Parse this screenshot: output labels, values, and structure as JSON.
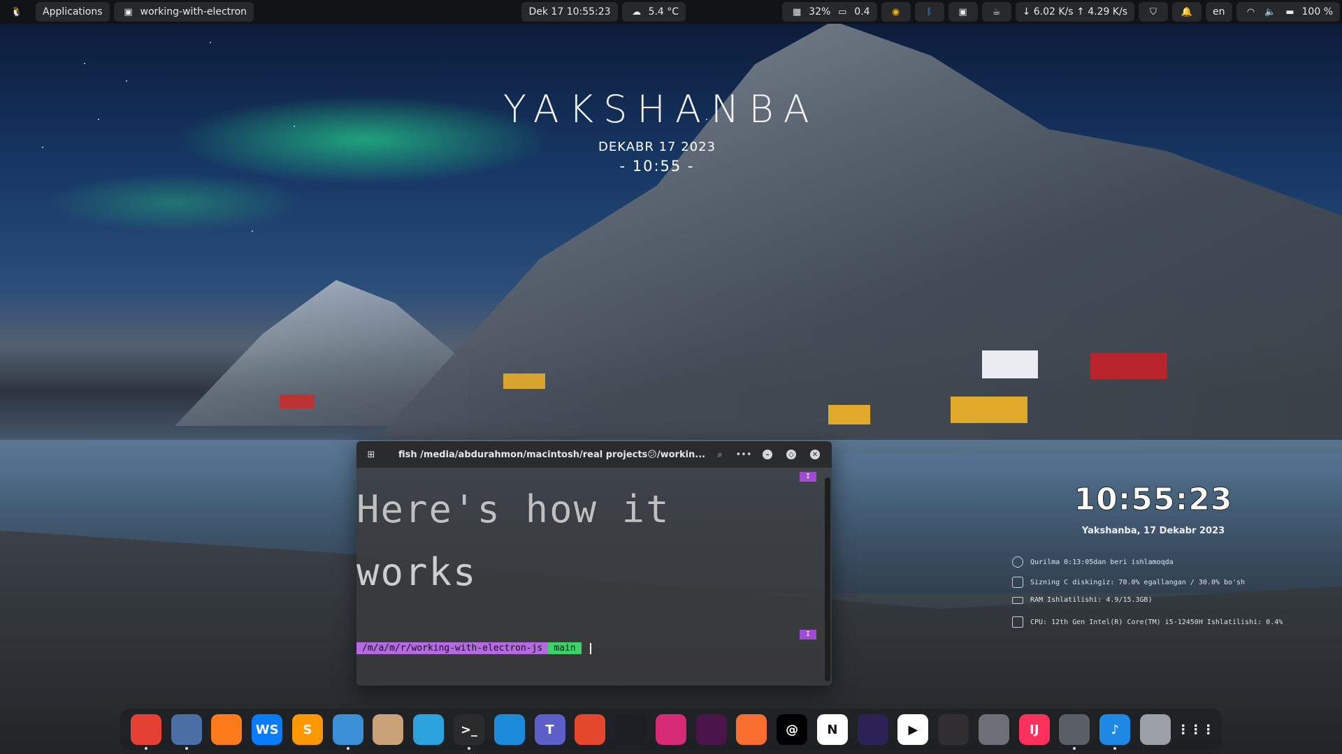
{
  "topbar": {
    "menu_label": "Applications",
    "window_label": "working-with-electron",
    "datetime": "Dek 17  10:55:23",
    "weather": "5.4 °C",
    "cpu": "32%",
    "load": "0.4",
    "network": "↓ 6.02 K/s ↑ 4.29 K/s",
    "language": "en",
    "battery": "100 %"
  },
  "desktop_clock": {
    "day": "YAKSHANBA",
    "date": "DEKABR 17 2023",
    "time": "- 10:55  -"
  },
  "widget": {
    "time": "10:55:23",
    "date": "Yakshanba, 17 Dekabr 2023",
    "uptime": "Qurilma 0:13:05dan beri ishlamoqda",
    "disk": "Sizning C diskingiz: 70.0% egallangan / 30.0% bo'sh",
    "ram": "RAM Ishlatilishi: 4.9/15.3GB)",
    "cpu": "CPU: 12th Gen Intel(R) Core(TM) i5-12450H Ishlatilishi: 0.4%"
  },
  "terminal": {
    "title": "fish /media/abdurahmon/macintosh/real projects😕/workin...",
    "ascii_line1": "Here's how it",
    "ascii_line2": "works",
    "prompt_path": "/m/a/m/r/working-with-electron-js",
    "prompt_branch": " main",
    "indicator": "I"
  },
  "dock": [
    {
      "name": "chrome",
      "label": "",
      "color": "#e44134",
      "active": true
    },
    {
      "name": "files-sync",
      "label": "",
      "color": "#4a6fa5",
      "active": true
    },
    {
      "name": "firefox",
      "label": "",
      "color": "#ff7a1a",
      "active": false
    },
    {
      "name": "webstorm",
      "label": "WS",
      "color": "#087cfa",
      "active": false
    },
    {
      "name": "sublime",
      "label": "S",
      "color": "#ff9800",
      "active": false
    },
    {
      "name": "file-manager",
      "label": "",
      "color": "#3a8fd6",
      "active": true
    },
    {
      "name": "archive-manager",
      "label": "",
      "color": "#c9a27a",
      "active": false
    },
    {
      "name": "telegram",
      "label": "",
      "color": "#2aa3df",
      "active": false
    },
    {
      "name": "terminal",
      "label": ">_",
      "color": "#2b2b2b",
      "active": true
    },
    {
      "name": "edge",
      "label": "",
      "color": "#1b8ad8",
      "active": false
    },
    {
      "name": "teams",
      "label": "T",
      "color": "#5b5fc7",
      "active": false
    },
    {
      "name": "postman-like",
      "label": "",
      "color": "#e4472b",
      "active": false
    },
    {
      "name": "github",
      "label": "",
      "color": "#1b1f23",
      "active": false
    },
    {
      "name": "instagram",
      "label": "",
      "color": "#d62976",
      "active": false
    },
    {
      "name": "slack",
      "label": "",
      "color": "#4a154b",
      "active": false
    },
    {
      "name": "figma-pen",
      "label": "",
      "color": "#f96d2f",
      "active": false
    },
    {
      "name": "threads",
      "label": "@",
      "color": "#000000",
      "active": false
    },
    {
      "name": "notion",
      "label": "N",
      "color": "#ffffff",
      "active": false
    },
    {
      "name": "eclipse",
      "label": "",
      "color": "#2c2255",
      "active": false
    },
    {
      "name": "media-player",
      "label": "▶",
      "color": "#ffffff",
      "active": false
    },
    {
      "name": "obs",
      "label": "",
      "color": "#302e31",
      "active": false
    },
    {
      "name": "settings",
      "label": "",
      "color": "#6c6f75",
      "active": false
    },
    {
      "name": "intellij",
      "label": "IJ",
      "color": "#fe315d",
      "active": false
    },
    {
      "name": "screenshot-tool",
      "label": "",
      "color": "#5a5f66",
      "active": true
    },
    {
      "name": "music",
      "label": "♪",
      "color": "#1e88e5",
      "active": true
    },
    {
      "name": "trash",
      "label": "",
      "color": "#9aa0a6",
      "active": false
    },
    {
      "name": "app-grid",
      "label": "⋮⋮⋮",
      "color": "#00000000",
      "active": false
    }
  ]
}
